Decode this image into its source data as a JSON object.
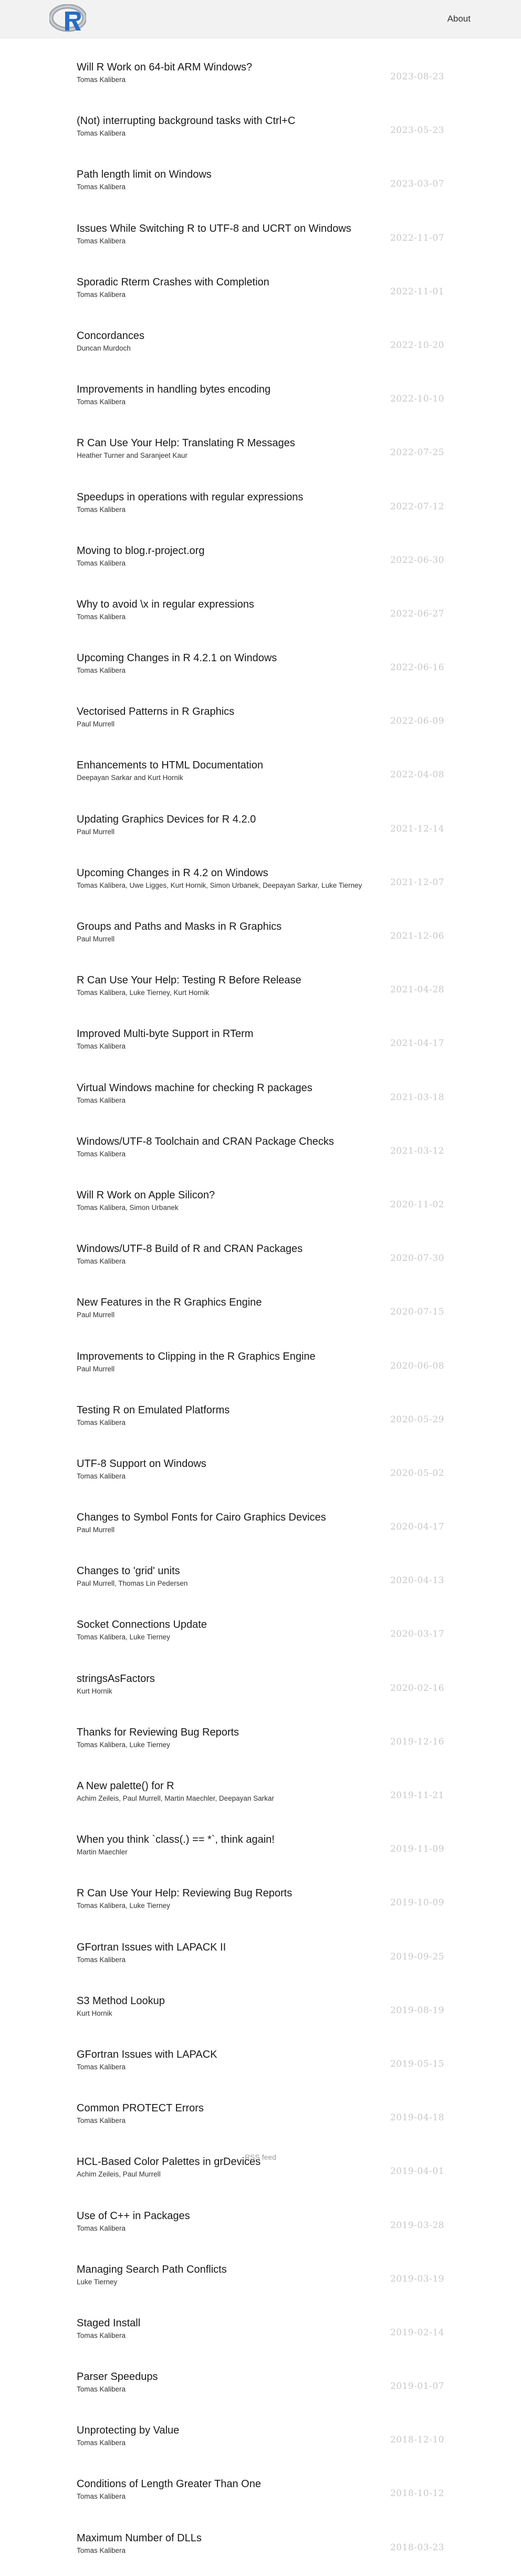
{
  "header": {
    "about_label": "About",
    "accent": "#276dc2",
    "logo_ring": "#9da2a8"
  },
  "posts": [
    {
      "title": "Will R Work on 64-bit ARM Windows?",
      "authors": "Tomas Kalibera",
      "date": "2023-08-23"
    },
    {
      "title": "(Not) interrupting background tasks with Ctrl+C",
      "authors": "Tomas Kalibera",
      "date": "2023-05-23"
    },
    {
      "title": "Path length limit on Windows",
      "authors": "Tomas Kalibera",
      "date": "2023-03-07"
    },
    {
      "title": "Issues While Switching R to UTF-8 and UCRT on Windows",
      "authors": "Tomas Kalibera",
      "date": "2022-11-07"
    },
    {
      "title": "Sporadic Rterm Crashes with Completion",
      "authors": "Tomas Kalibera",
      "date": "2022-11-01"
    },
    {
      "title": "Concordances",
      "authors": "Duncan Murdoch",
      "date": "2022-10-20"
    },
    {
      "title": "Improvements in handling bytes encoding",
      "authors": "Tomas Kalibera",
      "date": "2022-10-10"
    },
    {
      "title": "R Can Use Your Help: Translating R Messages",
      "authors": "Heather Turner and Saranjeet Kaur",
      "date": "2022-07-25"
    },
    {
      "title": "Speedups in operations with regular expressions",
      "authors": "Tomas Kalibera",
      "date": "2022-07-12"
    },
    {
      "title": "Moving to blog.r-project.org",
      "authors": "Tomas Kalibera",
      "date": "2022-06-30"
    },
    {
      "title": "Why to avoid \\x in regular expressions",
      "authors": "Tomas Kalibera",
      "date": "2022-06-27"
    },
    {
      "title": "Upcoming Changes in R 4.2.1 on Windows",
      "authors": "Tomas Kalibera",
      "date": "2022-06-16"
    },
    {
      "title": "Vectorised Patterns in R Graphics",
      "authors": "Paul Murrell",
      "date": "2022-06-09"
    },
    {
      "title": "Enhancements to HTML Documentation",
      "authors": "Deepayan Sarkar and Kurt Hornik",
      "date": "2022-04-08"
    },
    {
      "title": "Updating Graphics Devices for R 4.2.0",
      "authors": "Paul Murrell",
      "date": "2021-12-14"
    },
    {
      "title": "Upcoming Changes in R 4.2 on Windows",
      "authors": "Tomas Kalibera, Uwe Ligges, Kurt Hornik, Simon Urbanek, Deepayan Sarkar, Luke Tierney",
      "date": "2021-12-07"
    },
    {
      "title": "Groups and Paths and Masks in R Graphics",
      "authors": "Paul Murrell",
      "date": "2021-12-06"
    },
    {
      "title": "R Can Use Your Help: Testing R Before Release",
      "authors": "Tomas Kalibera, Luke Tierney, Kurt Hornik",
      "date": "2021-04-28"
    },
    {
      "title": "Improved Multi-byte Support in RTerm",
      "authors": "Tomas Kalibera",
      "date": "2021-04-17"
    },
    {
      "title": "Virtual Windows machine for checking R packages",
      "authors": "Tomas Kalibera",
      "date": "2021-03-18"
    },
    {
      "title": "Windows/UTF-8 Toolchain and CRAN Package Checks",
      "authors": "Tomas Kalibera",
      "date": "2021-03-12"
    },
    {
      "title": "Will R Work on Apple Silicon?",
      "authors": "Tomas Kalibera, Simon Urbanek",
      "date": "2020-11-02"
    },
    {
      "title": "Windows/UTF-8 Build of R and CRAN Packages",
      "authors": "Tomas Kalibera",
      "date": "2020-07-30"
    },
    {
      "title": "New Features in the R Graphics Engine",
      "authors": "Paul Murrell",
      "date": "2020-07-15"
    },
    {
      "title": "Improvements to Clipping in the R Graphics Engine",
      "authors": "Paul Murrell",
      "date": "2020-06-08"
    },
    {
      "title": "Testing R on Emulated Platforms",
      "authors": "Tomas Kalibera",
      "date": "2020-05-29"
    },
    {
      "title": "UTF-8 Support on Windows",
      "authors": "Tomas Kalibera",
      "date": "2020-05-02"
    },
    {
      "title": "Changes to Symbol Fonts for Cairo Graphics Devices",
      "authors": "Paul Murrell",
      "date": "2020-04-17"
    },
    {
      "title": "Changes to 'grid' units",
      "authors": "Paul Murrell, Thomas Lin Pedersen",
      "date": "2020-04-13"
    },
    {
      "title": "Socket Connections Update",
      "authors": "Tomas Kalibera, Luke Tierney",
      "date": "2020-03-17"
    },
    {
      "title": "stringsAsFactors",
      "authors": "Kurt Hornik",
      "date": "2020-02-16"
    },
    {
      "title": "Thanks for Reviewing Bug Reports",
      "authors": "Tomas Kalibera, Luke Tierney",
      "date": "2019-12-16"
    },
    {
      "title": "A New palette() for R",
      "authors": "Achim Zeileis, Paul Murrell, Martin Maechler, Deepayan Sarkar",
      "date": "2019-11-21"
    },
    {
      "title": "When you think `class(.) == *`, think again!",
      "authors": "Martin Maechler",
      "date": "2019-11-09"
    },
    {
      "title": "R Can Use Your Help: Reviewing Bug Reports",
      "authors": "Tomas Kalibera, Luke Tierney",
      "date": "2019-10-09"
    },
    {
      "title": "GFortran Issues with LAPACK II",
      "authors": "Tomas Kalibera",
      "date": "2019-09-25"
    },
    {
      "title": "S3 Method Lookup",
      "authors": "Kurt Hornik",
      "date": "2019-08-19"
    },
    {
      "title": "GFortran Issues with LAPACK",
      "authors": "Tomas Kalibera",
      "date": "2019-05-15"
    },
    {
      "title": "Common PROTECT Errors",
      "authors": "Tomas Kalibera",
      "date": "2019-04-18"
    },
    {
      "title": "HCL-Based Color Palettes in grDevices",
      "authors": "Achim Zeileis, Paul Murrell",
      "date": "2019-04-01"
    },
    {
      "title": "Use of C++ in Packages",
      "authors": "Tomas Kalibera",
      "date": "2019-03-28"
    },
    {
      "title": "Managing Search Path Conflicts",
      "authors": "Luke Tierney",
      "date": "2019-03-19"
    },
    {
      "title": "Staged Install",
      "authors": "Tomas Kalibera",
      "date": "2019-02-14"
    },
    {
      "title": "Parser Speedups",
      "authors": "Tomas Kalibera",
      "date": "2019-01-07"
    },
    {
      "title": "Unprotecting by Value",
      "authors": "Tomas Kalibera",
      "date": "2018-12-10"
    },
    {
      "title": "Conditions of Length Greater Than One",
      "authors": "Tomas Kalibera",
      "date": "2018-10-12"
    },
    {
      "title": "Maximum Number of DLLs",
      "authors": "Tomas Kalibera",
      "date": "2018-03-23"
    }
  ],
  "footer": {
    "rss_label": "RSS feed"
  }
}
